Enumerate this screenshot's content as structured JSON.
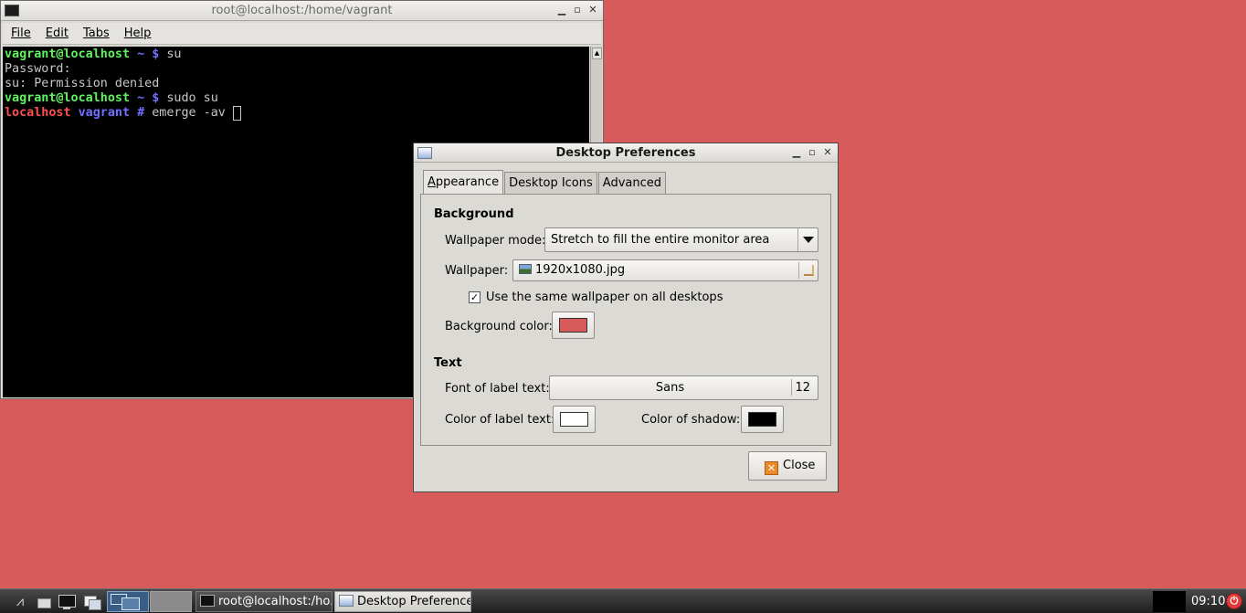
{
  "terminal": {
    "title": "root@localhost:/home/vagrant",
    "menu": [
      "File",
      "Edit",
      "Tabs",
      "Help"
    ],
    "lines": [
      {
        "user": "vagrant@localhost",
        "dir": "~",
        "sym": "$",
        "cmd": "su"
      },
      {
        "text": "Password:"
      },
      {
        "text": "su: Permission denied"
      },
      {
        "user": "vagrant@localhost",
        "dir": "~",
        "sym": "$",
        "cmd": "sudo su"
      },
      {
        "host": "localhost",
        "dir": "vagrant",
        "sym": "#",
        "cmd": "emerge -av "
      }
    ]
  },
  "dialog": {
    "title": "Desktop Preferences",
    "tabs": [
      "Appearance",
      "Desktop Icons",
      "Advanced"
    ],
    "background_heading": "Background",
    "wallpaper_mode_label": "Wallpaper mode:",
    "wallpaper_mode_value": "Stretch to fill the entire monitor area",
    "wallpaper_label": "Wallpaper:",
    "wallpaper_file": "1920x1080.jpg",
    "same_wallpaper_label": "Use the same wallpaper on all desktops",
    "same_wallpaper_checked": "✓",
    "background_color_label": "Background color:",
    "background_color": "#d85b5b",
    "text_heading": "Text",
    "font_label": "Font of label text:",
    "font_name": "Sans",
    "font_size": "12",
    "label_color_label": "Color of label text:",
    "label_color": "#ffffff",
    "shadow_color_label": "Color of shadow:",
    "shadow_color": "#000000",
    "close_label": "Close"
  },
  "taskbar": {
    "tasks": [
      "root@localhost:/ho...",
      "Desktop Preferences"
    ],
    "clock": "09:10"
  }
}
